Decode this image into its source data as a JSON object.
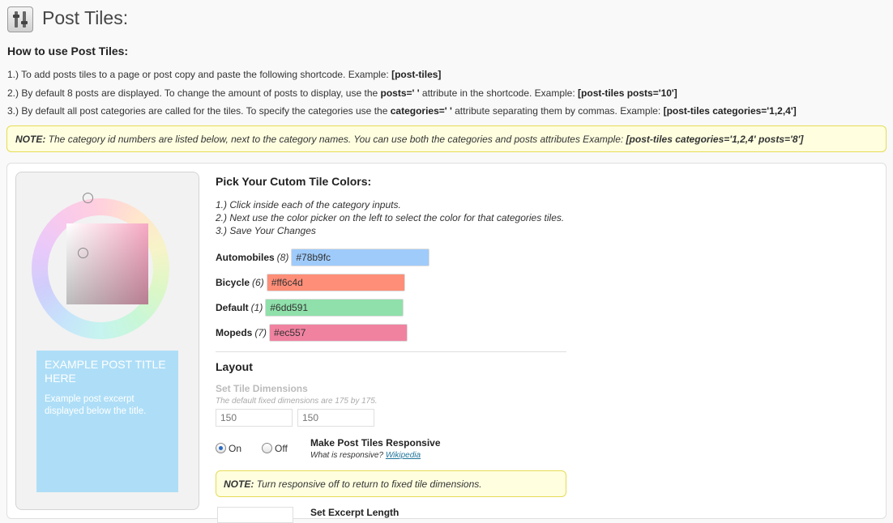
{
  "page": {
    "title": "Post Tiles:"
  },
  "howto": {
    "heading": "How to use Post Tiles:",
    "step1_text": "1.) To add posts tiles to a page or post copy and paste the following shortcode. Example: ",
    "step1_code": "[post-tiles]",
    "step2_text_a": "2.) By default 8 posts are displayed. To change the amount of posts to display, use the ",
    "step2_attr": "posts=' '",
    "step2_text_b": " attribute in the shortcode. Example: ",
    "step2_code": "[post-tiles posts='10']",
    "step3_text_a": "3.) By default all post categories are called for the tiles. To specify the categories use the ",
    "step3_attr": "categories=' '",
    "step3_text_b": " attribute separating them by commas. Example: ",
    "step3_code": "[post-tiles categories='1,2,4']"
  },
  "note_top": {
    "label": "NOTE:",
    "text": " The category id numbers are listed below, next to the category names. You can use both the categories and posts attributes Example: ",
    "code": "[post-tiles categories='1,2,4' posts='8']"
  },
  "preview": {
    "title": "EXAMPLE POST TITLE HERE",
    "excerpt": "Example post excerpt displayed below the title.",
    "tile_color": "#aedef7"
  },
  "colors_section": {
    "heading": "Pick Your Cutom Tile Colors:",
    "steps": [
      "1.) Click inside each of the category inputs.",
      "2.) Next use the color picker on the left to select the color for that categories tiles.",
      "3.) Save Your Changes"
    ],
    "categories": [
      {
        "name": "Automobiles",
        "count": "(8)",
        "value": "#78b9fc",
        "color": "#9fcbfb"
      },
      {
        "name": "Bicycle",
        "count": "(6)",
        "value": "#ff6c4d",
        "color": "#ff8e78"
      },
      {
        "name": "Default",
        "count": "(1)",
        "value": "#6dd591",
        "color": "#8fe0aa"
      },
      {
        "name": "Mopeds",
        "count": "(7)",
        "value": "#ec557",
        "color": "#f082a0"
      }
    ]
  },
  "layout": {
    "heading": "Layout",
    "dimensions_label": "Set Tile Dimensions",
    "dimensions_hint": "The default fixed dimensions are 175 by 175.",
    "width_placeholder": "150",
    "height_placeholder": "150",
    "radio_on": "On",
    "radio_off": "Off",
    "responsive_label": "Make Post Tiles Responsive",
    "responsive_hint": "What is responsive?",
    "responsive_link": "Wikipedia",
    "responsive_selected": "On",
    "note_label": "NOTE:",
    "note_text": " Turn responsive off to return to fixed tile dimensions.",
    "excerpt_label": "Set Excerpt Length"
  }
}
